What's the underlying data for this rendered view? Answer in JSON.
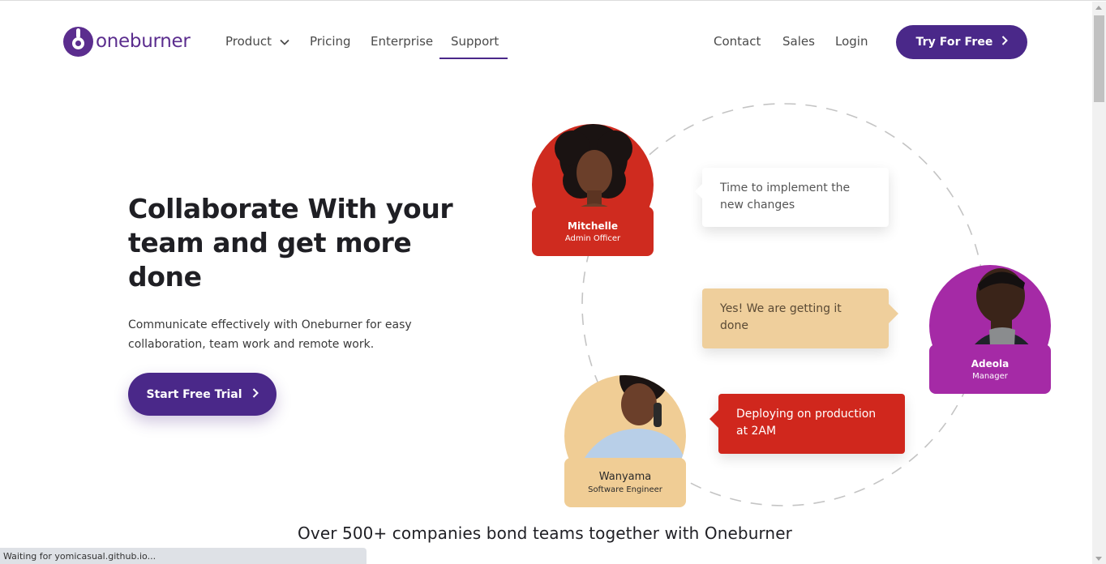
{
  "header": {
    "logo_text": "oneburner",
    "nav": {
      "product": "Product",
      "pricing": "Pricing",
      "enterprise": "Enterprise",
      "support": "Support"
    },
    "right_nav": {
      "contact": "Contact",
      "sales": "Sales",
      "login": "Login"
    },
    "cta": "Try For Free",
    "active_nav": "Support"
  },
  "hero": {
    "title": "Collaborate With your team and get more done",
    "subtitle": "Communicate effectively with Oneburner for easy collaboration, team work and remote work.",
    "cta": "Start Free Trial"
  },
  "illustration": {
    "people": [
      {
        "name": "Mitchelle",
        "role": "Admin Officer",
        "color": "#cf2b1f"
      },
      {
        "name": "Adeola",
        "role": "Manager",
        "color": "#a52aa6"
      },
      {
        "name": "Wanyama",
        "role": "Software Engineer",
        "color": "#f0cd95"
      }
    ],
    "messages": [
      {
        "text": "Time to implement the new changes",
        "bg": "#ffffff"
      },
      {
        "text": "Yes! We are getting it done",
        "bg": "#efcf9c"
      },
      {
        "text": "Deploying on production at 2AM",
        "bg": "#d0271d"
      }
    ]
  },
  "companies_text": "Over 500+ companies bond teams together with Oneburner",
  "browser": {
    "status_text": "Waiting for yomicasual.github.io..."
  },
  "colors": {
    "brand": "#4a2889",
    "logo": "#5b2d8e"
  }
}
